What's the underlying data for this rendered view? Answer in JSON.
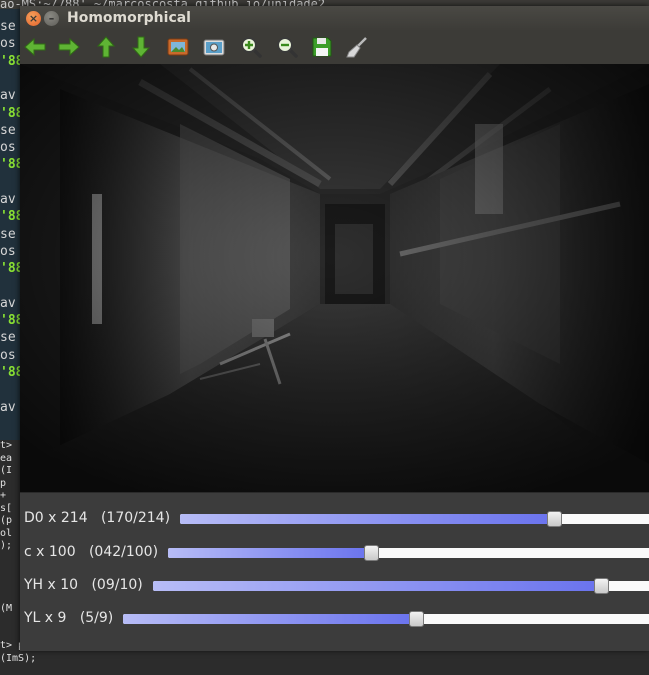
{
  "window": {
    "title": "Homomorphical"
  },
  "toolbar": {
    "buttons": [
      {
        "name": "back",
        "icon": "arrow-left-icon"
      },
      {
        "name": "forward",
        "icon": "arrow-right-icon"
      },
      {
        "name": "up",
        "icon": "arrow-up-icon"
      },
      {
        "name": "down",
        "icon": "arrow-down-icon"
      },
      {
        "name": "image",
        "icon": "picture-icon"
      },
      {
        "name": "screenshot",
        "icon": "screenshot-icon"
      },
      {
        "name": "zoom-in",
        "icon": "zoom-in-icon"
      },
      {
        "name": "zoom-out",
        "icon": "zoom-out-icon"
      },
      {
        "name": "save",
        "icon": "save-icon"
      },
      {
        "name": "clear",
        "icon": "brush-icon"
      }
    ]
  },
  "trackbars": [
    {
      "label": "D0 x 214",
      "readout": "(170/214)",
      "value": 170,
      "max": 214
    },
    {
      "label": "c x 100",
      "readout": "(042/100)",
      "value": 42,
      "max": 100
    },
    {
      "label": "YH x 10",
      "readout": "(09/10)",
      "value": 9,
      "max": 10
    },
    {
      "label": "YL x 9",
      "readout": "(5/9)",
      "value": 5,
      "max": 9
    }
  ],
  "terminal": {
    "title": "ao-MS:~/788' ~/marcoscosta.github.io/unidade2",
    "lines_top": [
      "se",
      "os",
      "'88",
      "",
      "av",
      "'88",
      "se",
      "os",
      "'88",
      "",
      "av",
      "'88",
      "se",
      "os",
      "'88",
      "",
      "av",
      "'88",
      "se",
      "os",
      "'88",
      "",
      "av"
    ],
    "lines_bottom": [
      "t>",
      "ea",
      "(I",
      "p",
      "+",
      "s[",
      "(p",
      "ol",
      ");",
      "",
      "",
      "",
      "",
      "(M",
      "",
      "",
      "t> planes;",
      "(ImS);"
    ]
  },
  "colors": {
    "accent": "#6a73ee",
    "terminal_green": "#8ae234"
  }
}
